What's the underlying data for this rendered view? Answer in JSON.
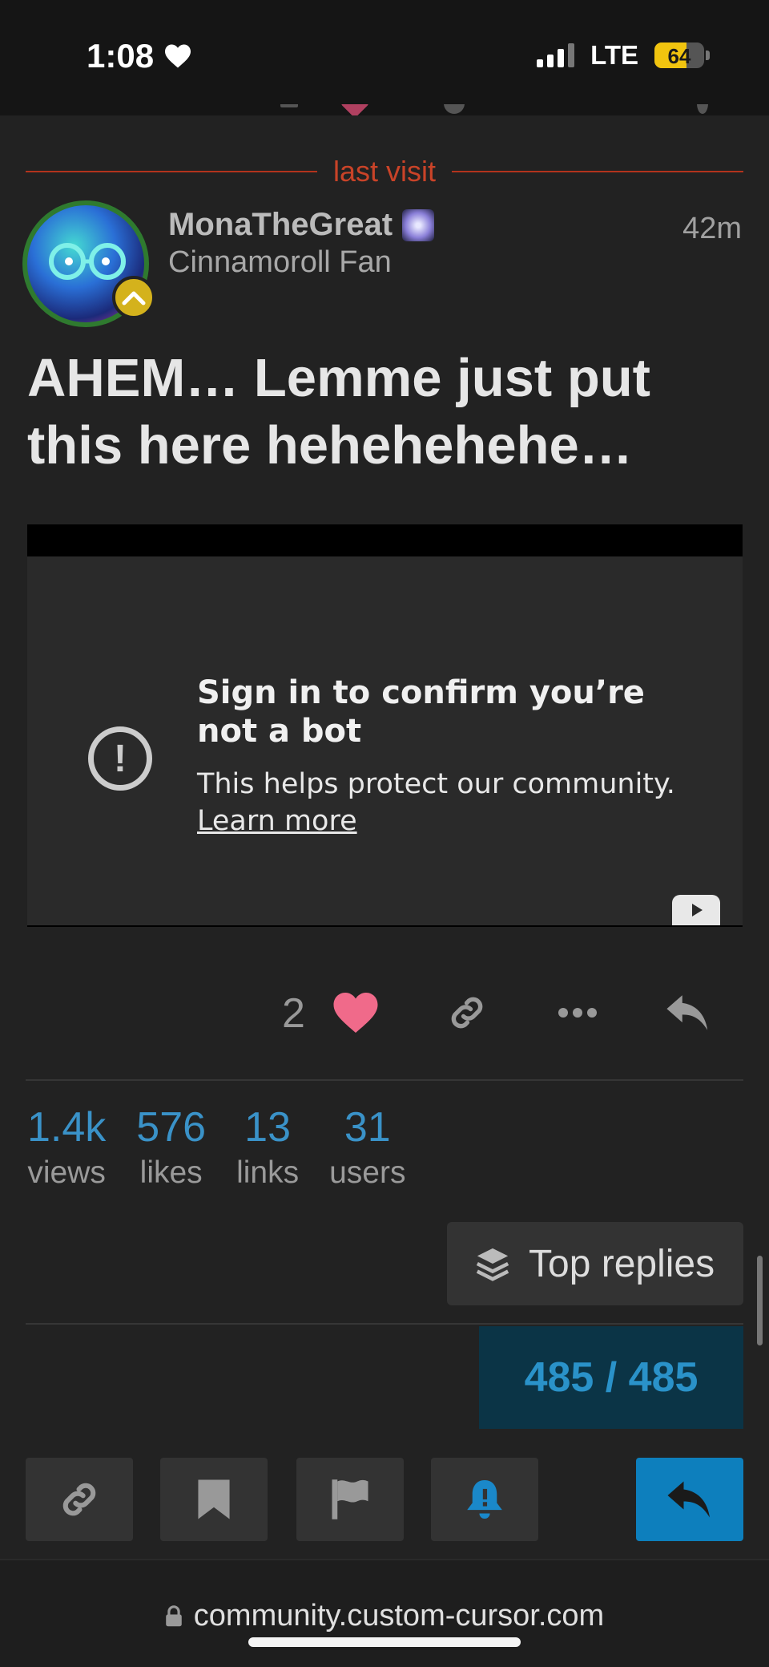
{
  "status_bar": {
    "time": "1:08",
    "network": "LTE",
    "battery_level": "64",
    "battery_color": "#f1c40f"
  },
  "divider": {
    "label": "last visit"
  },
  "post": {
    "username": "MonaTheGreat",
    "user_title": "Cinnamoroll Fan",
    "time": "42m",
    "title": "AHEM… Lemme just put this here hehehehehe…",
    "embed": {
      "heading": "Sign in to confirm you’re not a bot",
      "body": "This helps protect our community.",
      "link": "Learn more"
    },
    "like_count": "2",
    "like_color": "#f06a8a"
  },
  "stats": [
    {
      "value": "1.4k",
      "label": "views"
    },
    {
      "value": "576",
      "label": "likes"
    },
    {
      "value": "13",
      "label": "links"
    },
    {
      "value": "31",
      "label": "users"
    }
  ],
  "top_replies_label": "Top replies",
  "progress": "485 / 485",
  "accent_color": "#0d7fbd",
  "url": "community.custom-cursor.com",
  "icons": {
    "actions": [
      "link-icon",
      "ellipsis-icon",
      "reply-icon"
    ],
    "footer": [
      "link-icon",
      "bookmark-icon",
      "flag-icon",
      "bell-icon",
      "reply-icon"
    ]
  }
}
